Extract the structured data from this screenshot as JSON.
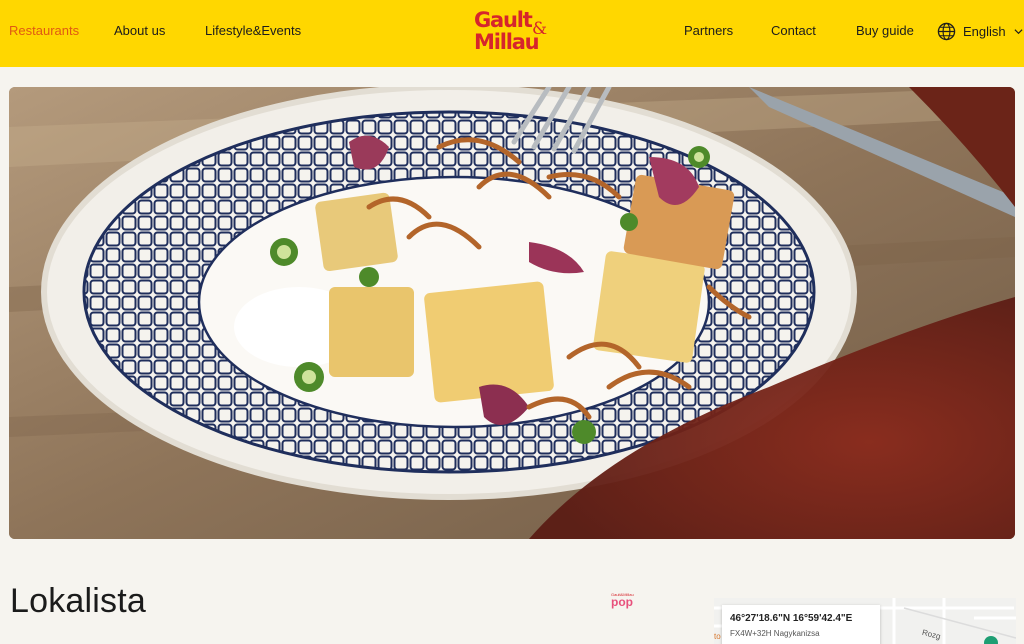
{
  "nav": {
    "left": [
      {
        "label": "Restaurants",
        "active": true
      },
      {
        "label": "About us",
        "active": false
      },
      {
        "label": "Lifestyle&Events",
        "active": false
      }
    ],
    "right": [
      {
        "label": "Partners"
      },
      {
        "label": "Contact"
      },
      {
        "label": "Buy guide"
      }
    ],
    "language": "English",
    "icons": {
      "language": "globe-icon",
      "dropdown": "chevron-down-icon"
    }
  },
  "logo": {
    "line1": "Gault",
    "line2": "Millau",
    "amp": "&"
  },
  "colors": {
    "header_bg": "#ffd700",
    "active_link": "#e05a12",
    "logo_red": "#d6252c",
    "page_bg": "#f6f4ef",
    "pop_pink": "#e8507c"
  },
  "hero": {
    "alt_description": ""
  },
  "restaurant": {
    "name": "Lokalista"
  },
  "badge": {
    "small_text": "Gault&Millau",
    "word": "pop"
  },
  "map": {
    "coordinates": "46°27'18.6\"N 16°59'42.4\"E",
    "plus_code": "FX4W+32H Nagykanizsa",
    "road_label": "Rozg",
    "edge_label": "to"
  }
}
